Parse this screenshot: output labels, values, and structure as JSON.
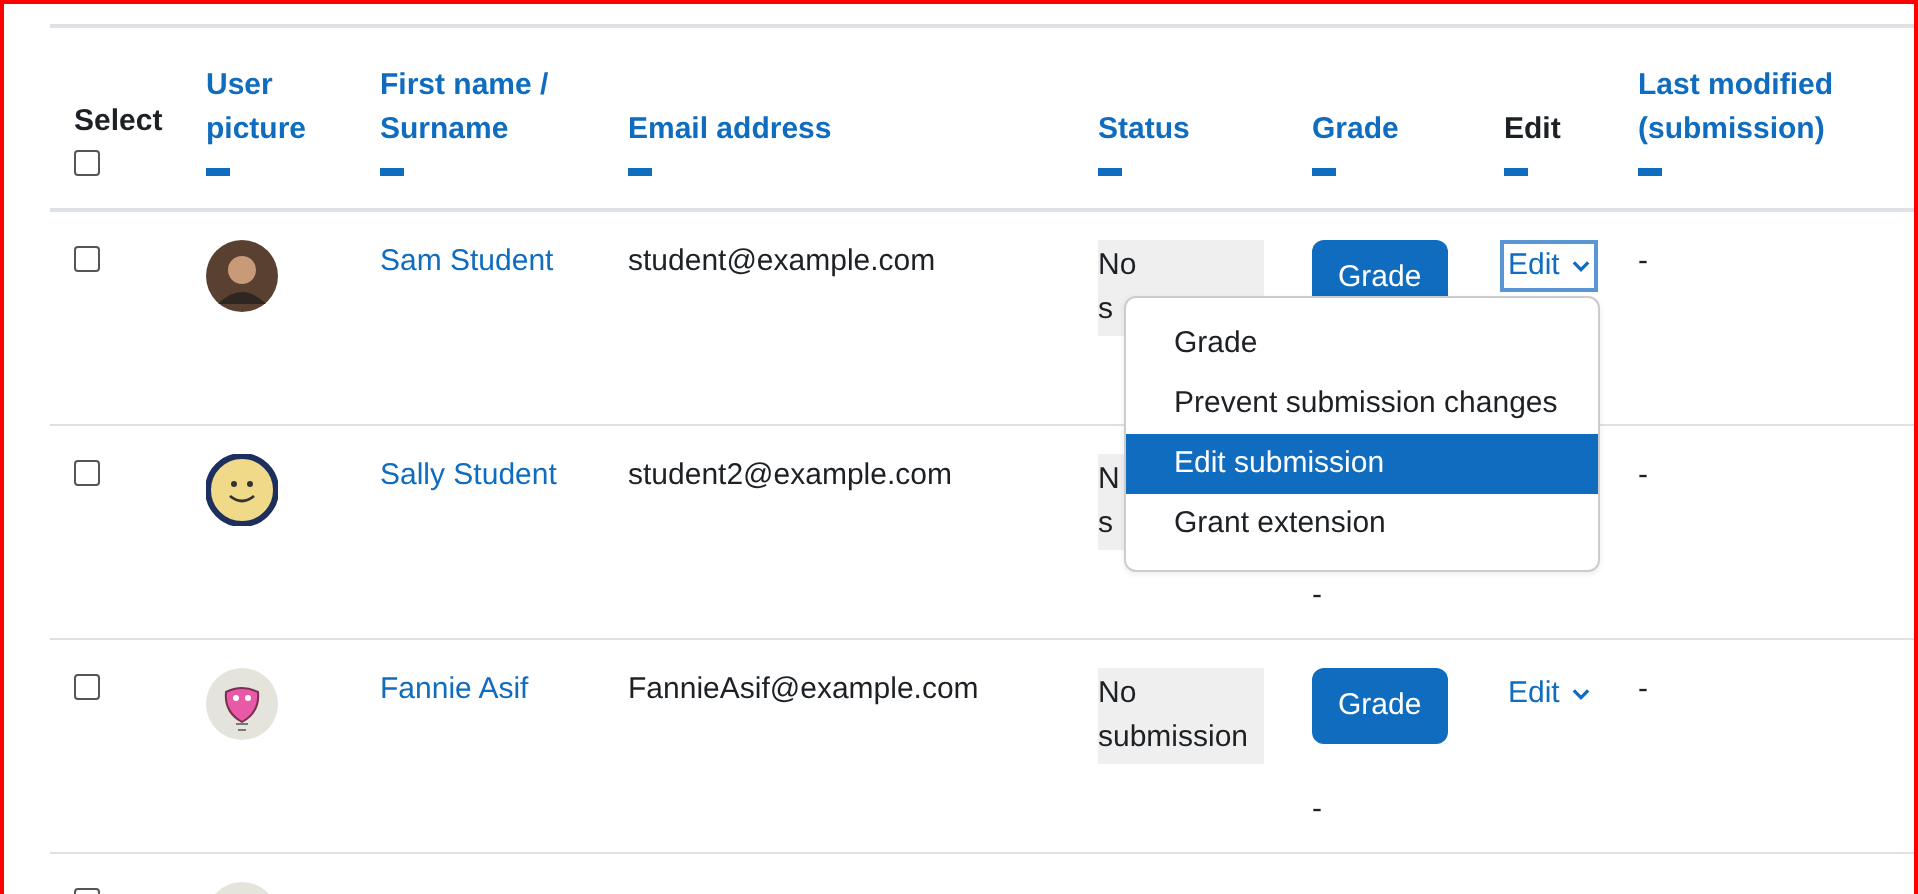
{
  "table": {
    "columns": [
      {
        "label": "Select",
        "kind": "select",
        "sortable": false,
        "checked": false
      },
      {
        "label": "User picture",
        "kind": "link",
        "sortable": true
      },
      {
        "label": "First name / Surname",
        "kind": "link",
        "sortable": true
      },
      {
        "label": "Email address",
        "kind": "link",
        "sortable": true
      },
      {
        "label": "Status",
        "kind": "link",
        "sortable": true
      },
      {
        "label": "Grade",
        "kind": "link",
        "sortable": true
      },
      {
        "label": "Edit",
        "kind": "plain",
        "sortable": true
      },
      {
        "label": "Last modified (submission)",
        "kind": "link",
        "sortable": true
      }
    ],
    "rows": [
      {
        "checked": false,
        "avatar": {
          "kind": "photo"
        },
        "name": "Sam Student",
        "email": "student@example.com",
        "status": [
          "No",
          "s"
        ],
        "grade_button": "Grade",
        "edit": "Edit",
        "edit_focused": true,
        "last_modified": "-"
      },
      {
        "checked": false,
        "avatar": {
          "kind": "smiley"
        },
        "name": "Sally Student",
        "email": "student2@example.com",
        "status": [
          "N",
          "s"
        ],
        "grade_note": "-",
        "last_modified": "-"
      },
      {
        "checked": false,
        "avatar": {
          "kind": "drawing"
        },
        "name": "Fannie Asif",
        "email": "FannieAsif@example.com",
        "status": [
          "No",
          "submission"
        ],
        "grade_button": "Grade",
        "grade_note": "-",
        "edit": "Edit",
        "edit_focused": false,
        "last_modified": "-"
      },
      {
        "checked": false,
        "avatar": {
          "kind": "drawing"
        }
      }
    ]
  },
  "action_menu": {
    "items": [
      {
        "label": "Grade",
        "selected": false
      },
      {
        "label": "Prevent submission changes",
        "selected": false
      },
      {
        "label": "Edit submission",
        "selected": true
      },
      {
        "label": "Grant extension",
        "selected": false
      }
    ]
  }
}
